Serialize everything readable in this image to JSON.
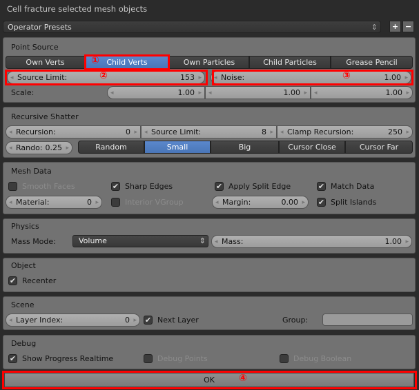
{
  "title": "Cell fracture selected mesh objects",
  "presets": {
    "label": "Operator Presets",
    "add": "+",
    "remove": "−"
  },
  "point_source": {
    "header": "Point Source",
    "options": [
      "Own Verts",
      "Child Verts",
      "Own Particles",
      "Child Particles",
      "Grease Pencil"
    ],
    "active": "Child Verts",
    "source_limit": {
      "label": "Source Limit:",
      "value": "153"
    },
    "noise": {
      "label": "Noise:",
      "value": "1.00"
    },
    "scale": {
      "label": "Scale:",
      "values": [
        "1.00",
        "1.00",
        "1.00"
      ]
    }
  },
  "recursive": {
    "header": "Recursive Shatter",
    "recursion": {
      "label": "Recursion:",
      "value": "0"
    },
    "source_limit": {
      "label": "Source Limit:",
      "value": "8"
    },
    "clamp": {
      "label": "Clamp Recursion:",
      "value": "250"
    },
    "rando": {
      "label": "Rando:",
      "value": "0.25"
    },
    "modes": [
      "Random",
      "Small",
      "Big",
      "Cursor Close",
      "Cursor Far"
    ],
    "active": "Small"
  },
  "mesh": {
    "header": "Mesh Data",
    "smooth_faces": "Smooth Faces",
    "sharp_edges": "Sharp Edges",
    "apply_split": "Apply Split Edge",
    "match_data": "Match Data",
    "material": {
      "label": "Material:",
      "value": "0"
    },
    "interior_vgroup": "Interior VGroup",
    "margin": {
      "label": "Margin:",
      "value": "0.00"
    },
    "split_islands": "Split Islands"
  },
  "physics": {
    "header": "Physics",
    "mass_mode_label": "Mass Mode:",
    "mass_mode": "Volume",
    "mass": {
      "label": "Mass:",
      "value": "1.00"
    }
  },
  "object": {
    "header": "Object",
    "recenter": "Recenter"
  },
  "scene": {
    "header": "Scene",
    "layer_index": {
      "label": "Layer Index:",
      "value": "0"
    },
    "next_layer": "Next Layer",
    "group_label": "Group:",
    "group_value": ""
  },
  "debug": {
    "header": "Debug",
    "show_progress": "Show Progress Realtime",
    "debug_points": "Debug Points",
    "debug_boolean": "Debug Boolean"
  },
  "ok": "OK",
  "annotations": [
    "①",
    "②",
    "③",
    "④"
  ],
  "colors": {
    "active": "#5680c2",
    "highlight": "#ff0000",
    "panel": "#727272"
  }
}
